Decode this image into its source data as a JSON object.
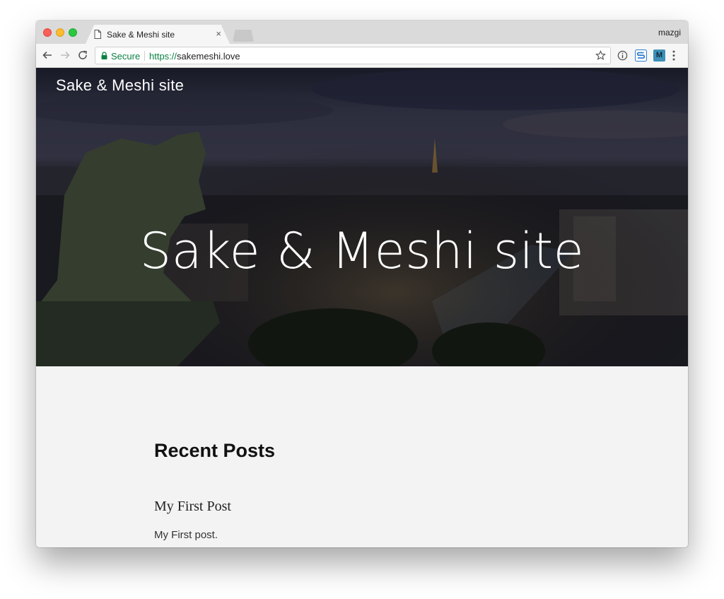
{
  "browser": {
    "tab": {
      "title": "Sake & Meshi site",
      "close_glyph": "×"
    },
    "profile_name": "mazgi",
    "toolbar": {
      "security_label": "Secure",
      "url_scheme": "https://",
      "url_host": "sakemeshi.love"
    },
    "icons": {
      "back": "back-arrow-icon",
      "forward": "forward-arrow-icon",
      "reload": "reload-icon",
      "bookmark": "star-icon",
      "info": "info-icon",
      "extension_1": "extension-s-icon",
      "extension_2": "extension-m-icon",
      "menu": "kebab-menu-icon"
    },
    "extensions": {
      "ext1_letter": "S",
      "ext2_letter": "M"
    }
  },
  "site": {
    "header_title": "Sake & Meshi site",
    "hero_title": "Sake & Meshi site"
  },
  "content": {
    "section_heading": "Recent Posts",
    "posts": [
      {
        "title": "My First Post",
        "excerpt": "My First post."
      }
    ]
  },
  "colors": {
    "secure_green": "#0b8043",
    "ext_s_blue": "#2f7dd1",
    "ext_m_teal": "#3d8fb8"
  }
}
